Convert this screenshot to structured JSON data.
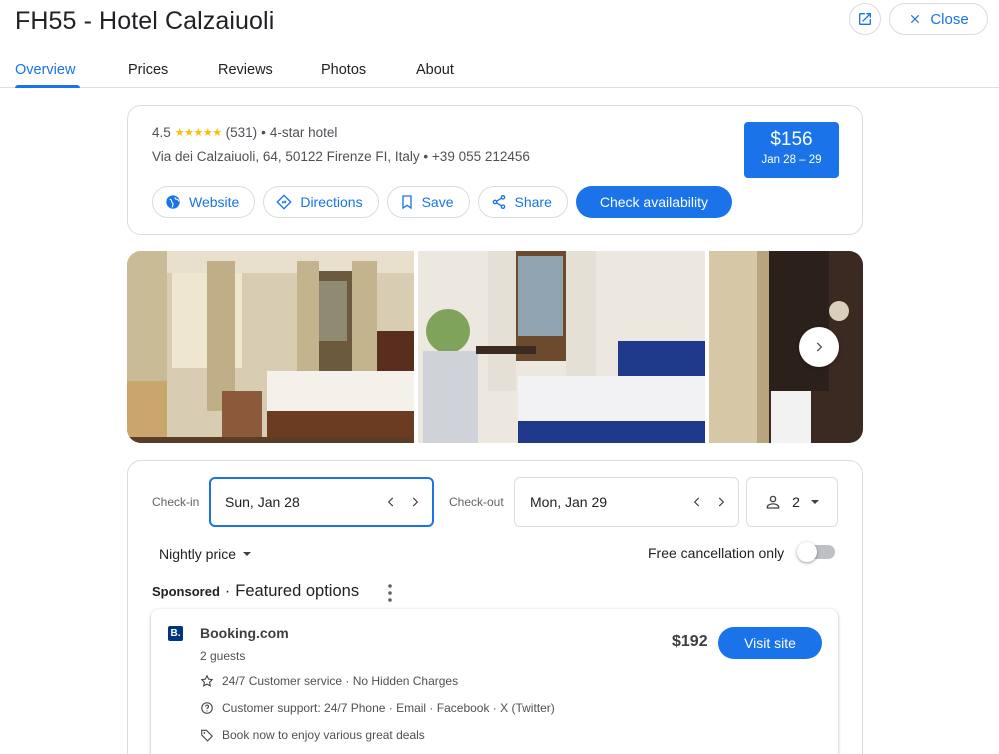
{
  "header": {
    "title": "FH55 - Hotel Calzaiuoli",
    "close_label": "Close"
  },
  "tabs": [
    {
      "label": "Overview",
      "active": true
    },
    {
      "label": "Prices",
      "active": false
    },
    {
      "label": "Reviews",
      "active": false
    },
    {
      "label": "Photos",
      "active": false
    },
    {
      "label": "About",
      "active": false
    }
  ],
  "overview": {
    "rating": "4.5",
    "stars_glyph": "★★★★★",
    "review_count": "(531)",
    "separator": "•",
    "hotel_class": "4-star hotel",
    "address": "Via dei Calzaiuoli, 64, 50122 Firenze FI, Italy",
    "phone": "+39 055 212456",
    "price": "$156",
    "price_dates": "Jan 28 – 29",
    "actions": {
      "website": "Website",
      "directions": "Directions",
      "save": "Save",
      "share": "Share",
      "check_availability": "Check availability"
    }
  },
  "booking": {
    "checkin_label": "Check-in",
    "checkin_value": "Sun, Jan 28",
    "checkout_label": "Check-out",
    "checkout_value": "Mon, Jan 29",
    "guests": "2",
    "price_mode": "Nightly price",
    "free_cancellation_label": "Free cancellation only",
    "free_cancellation_on": false,
    "sponsored_label": "Sponsored",
    "dot": "·",
    "featured_label": "Featured options"
  },
  "offer": {
    "logo_letter": "B.",
    "provider": "Booking.com",
    "guests": "2 guests",
    "price": "$192",
    "visit_label": "Visit site",
    "features": [
      "24/7 Customer service · No Hidden Charges",
      "Customer support: 24/7 Phone · Email · Facebook · X (Twitter)",
      "Book now to enjoy various great deals"
    ]
  },
  "colors": {
    "accent": "#1a73e8",
    "star": "#fbbc04",
    "booking_brand": "#003580"
  }
}
